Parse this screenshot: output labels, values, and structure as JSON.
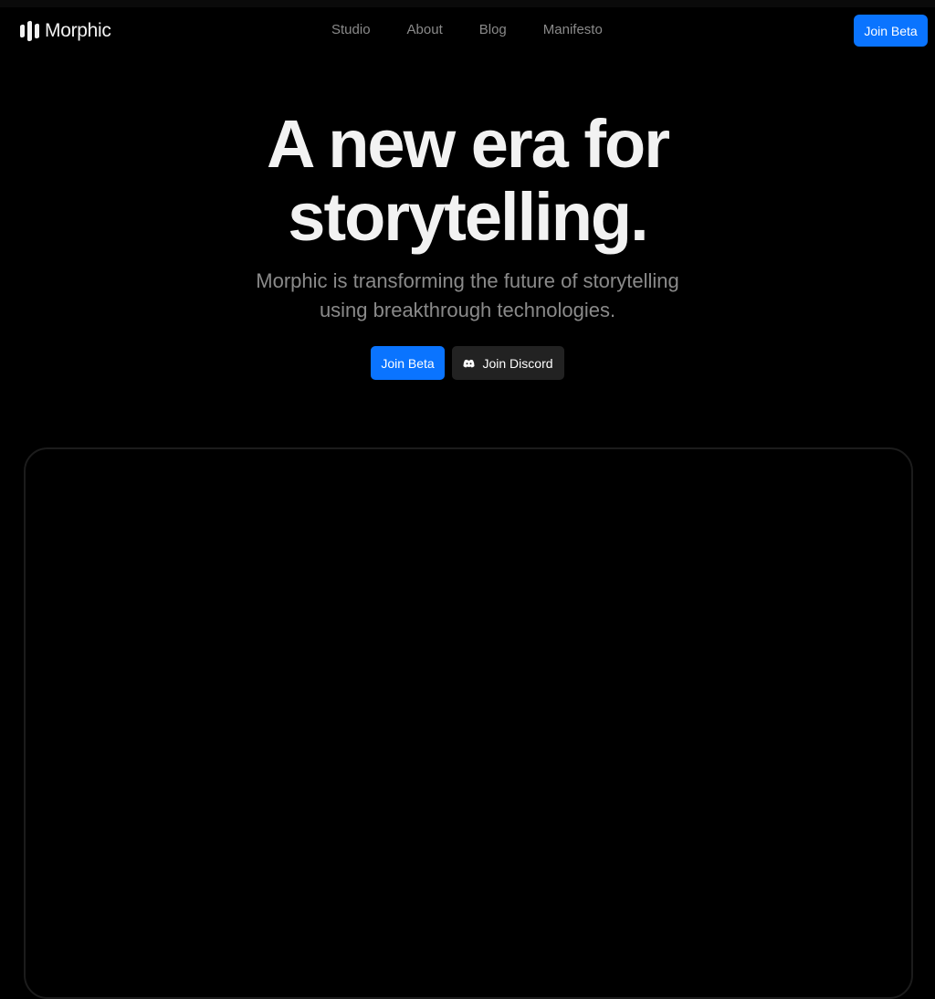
{
  "brand": {
    "name": "Morphic"
  },
  "nav": {
    "links": [
      {
        "label": "Studio"
      },
      {
        "label": "About"
      },
      {
        "label": "Blog"
      },
      {
        "label": "Manifesto"
      }
    ],
    "cta_label": "Join Beta"
  },
  "hero": {
    "title_line1": "A new era for",
    "title_line2": "storytelling.",
    "subtitle_line1": "Morphic is transforming the future of storytelling",
    "subtitle_line2": "using breakthrough technologies.",
    "primary_cta": "Join Beta",
    "secondary_cta": "Join Discord",
    "secondary_icon": "discord-icon"
  },
  "colors": {
    "accent": "#0a74ff",
    "background": "#000000",
    "muted_text": "#8a8a8a",
    "secondary_button": "#222222"
  }
}
